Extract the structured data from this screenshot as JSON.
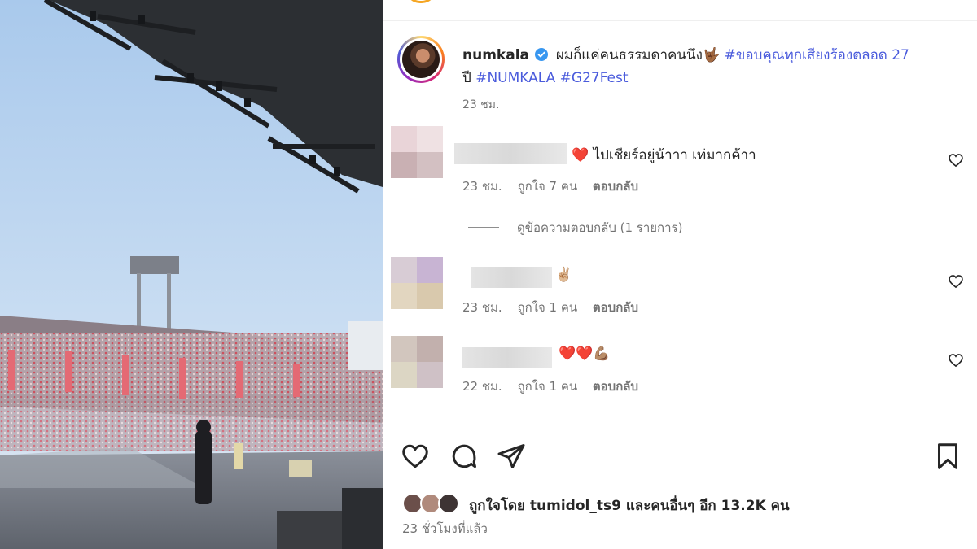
{
  "post": {
    "username": "numkala",
    "caption_text": "ผมก็แค่คนธรรมดาคนนึง🤟🏾",
    "hashtag_line1": "#ขอบคุณทุกเสียงร้องตลอด 27",
    "caption_line2_prefix": "ปี",
    "hashtags": [
      "#NUMKALA",
      "#G27Fest"
    ],
    "caption_time": "23 ชม."
  },
  "comments": [
    {
      "text": "❤️ ไปเชียร์อยู่น้าาา เท่มากค้าา",
      "time": "23 ชม.",
      "likes": "ถูกใจ 7 คน",
      "reply_label": "ตอบกลับ",
      "avatar_colors": [
        "#e9d4d8",
        "#efe1e3",
        "#c9b0b3",
        "#d3c0c2"
      ]
    },
    {
      "text": "✌🏼",
      "time": "23 ชม.",
      "likes": "ถูกใจ 1 คน",
      "reply_label": "ตอบกลับ",
      "avatar_colors": [
        "#d8ccd5",
        "#c8b4d3",
        "#e2d6c0",
        "#d9c9ad"
      ]
    },
    {
      "text": "❤️❤️💪🏽",
      "time": "22 ชม.",
      "likes": "ถูกใจ 1 คน",
      "reply_label": "ตอบกลับ",
      "avatar_colors": [
        "#d2c6be",
        "#c2b0ad",
        "#dcd6c4",
        "#cfc1c6"
      ]
    }
  ],
  "view_replies": "ดูข้อความตอบกลับ (1 รายการ)",
  "likes_summary": "ถูกใจโดย tumidol_ts9 และคนอื่นๆ อีก 13.2K คน",
  "post_time": "23 ชั่วโมงที่แล้ว",
  "colors": {
    "hashtag": "#4a5bdc",
    "verified": "#3897f0",
    "heart_red": "#ed1c24",
    "muted_text": "#737373"
  },
  "icons": [
    "verified-badge-icon",
    "heart-outline-icon",
    "comment-icon",
    "share-icon",
    "bookmark-icon"
  ]
}
